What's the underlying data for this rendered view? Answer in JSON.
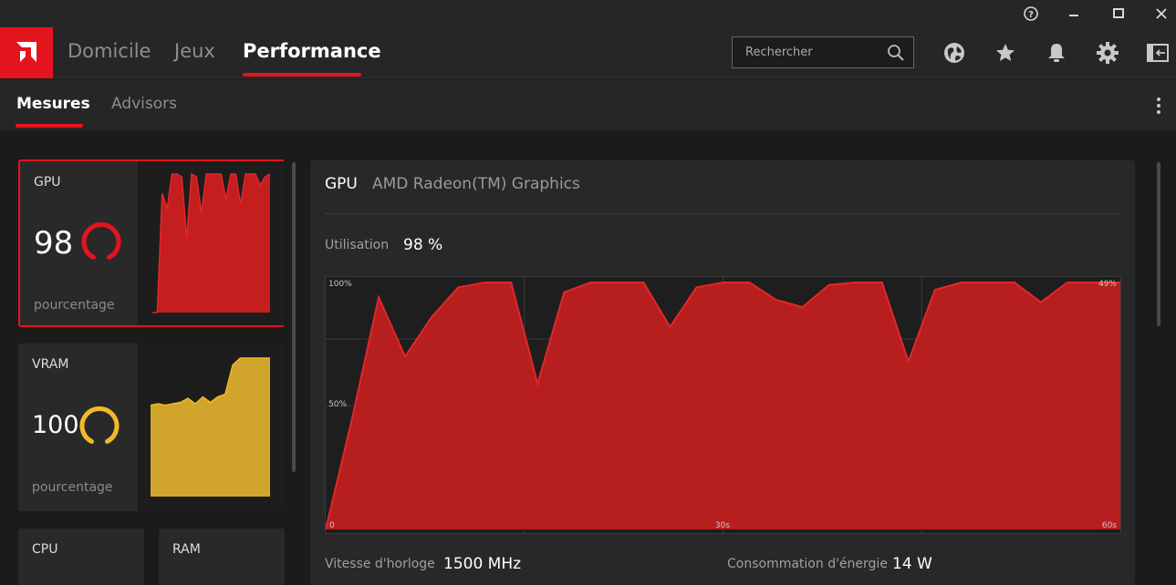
{
  "titlebar": {
    "help_icon": "question-circle-icon",
    "minimize_icon": "minimize-icon",
    "maximize_icon": "maximize-icon",
    "close_icon": "close-icon"
  },
  "nav": {
    "logo": "amd-logo",
    "items": [
      {
        "label": "Domicile"
      },
      {
        "label": "Jeux"
      },
      {
        "label": "Performance"
      }
    ],
    "search_placeholder": "Rechercher",
    "icons": [
      "globe-icon",
      "star-icon",
      "bell-icon",
      "gear-icon",
      "sidebar-toggle-icon"
    ],
    "accent_color": "#e3141e"
  },
  "subnav": {
    "items": [
      {
        "label": "Mesures"
      },
      {
        "label": "Advisors"
      }
    ]
  },
  "cards": [
    {
      "label": "GPU",
      "value": "98",
      "unit": "pourcentage",
      "color": "#c41e1e",
      "gauge_color": "#e3141e",
      "gauge_level": 0.98
    },
    {
      "label": "VRAM",
      "value": "100",
      "unit": "pourcentage",
      "color": "#d1a42b",
      "gauge_color": "#f2b928",
      "gauge_level": 1.0
    },
    {
      "label": "CPU"
    },
    {
      "label": "RAM"
    }
  ],
  "detail": {
    "name": "GPU",
    "model": "AMD Radeon(TM) Graphics",
    "utilisation_label": "Utilisation",
    "utilisation_value": "98 %",
    "clock_label": "Vitesse d'horloge",
    "clock_value": "1500 MHz",
    "power_label": "Consommation d'énergie",
    "power_value": "14 W"
  },
  "chart_data": {
    "type": "area",
    "series": [
      {
        "color": "#c41e1e",
        "x": [
          0,
          1,
          2,
          3,
          4,
          5,
          6,
          7,
          8,
          9,
          10,
          11,
          12,
          13,
          14,
          15,
          16,
          17,
          18,
          19,
          20,
          21,
          22,
          23,
          24,
          25,
          26,
          27,
          28,
          29,
          30
        ],
        "values": [
          0,
          45,
          94,
          70,
          86,
          98,
          100,
          100,
          59,
          96,
          100,
          100,
          100,
          82,
          98,
          100,
          100,
          93,
          90,
          99,
          100,
          100,
          68,
          97,
          100,
          100,
          100,
          92,
          100,
          100,
          100
        ]
      }
    ],
    "ylim": [
      0,
      100
    ],
    "y_tick_labels": [
      "100%",
      "50%"
    ],
    "x_tick_labels": [
      "0",
      "30s",
      "60s"
    ],
    "corner_label": "49%",
    "grid": true
  },
  "sparklines": {
    "gpu": [
      0,
      0,
      86,
      75,
      100,
      100,
      98,
      53,
      100,
      98,
      72,
      100,
      100,
      100,
      100,
      82,
      100,
      100,
      78,
      100,
      100,
      100,
      92,
      98,
      100
    ],
    "vram": [
      66,
      67,
      66,
      67,
      68,
      71,
      67,
      72,
      68,
      72,
      74,
      95,
      100,
      100,
      100,
      100,
      100
    ]
  }
}
